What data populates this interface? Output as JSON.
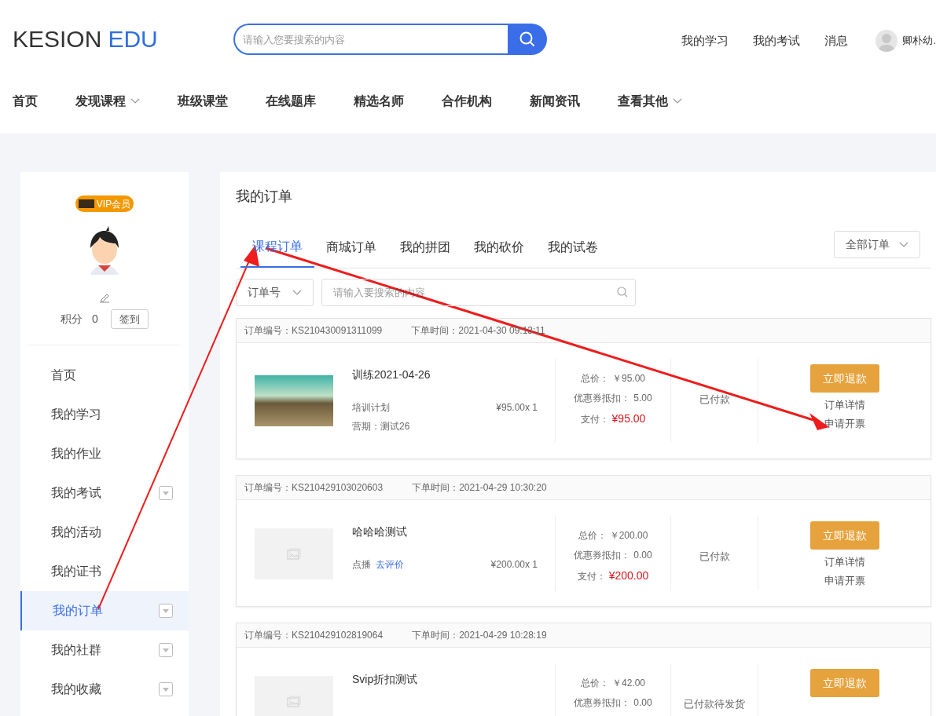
{
  "logo": {
    "part1": "KESION",
    "part2": "EDU"
  },
  "search": {
    "placeholder": "请输入您要搜索的内容"
  },
  "top_links": [
    "我的学习",
    "我的考试",
    "消息"
  ],
  "user": {
    "name": "卿朴幼."
  },
  "nav": [
    {
      "label": "首页",
      "dropdown": false
    },
    {
      "label": "发现课程",
      "dropdown": true
    },
    {
      "label": "班级课堂",
      "dropdown": false
    },
    {
      "label": "在线题库",
      "dropdown": false
    },
    {
      "label": "精选名师",
      "dropdown": false
    },
    {
      "label": "合作机构",
      "dropdown": false
    },
    {
      "label": "新闻资讯",
      "dropdown": false
    },
    {
      "label": "查看其他",
      "dropdown": true
    }
  ],
  "profile": {
    "badge": "VIP会员",
    "points_label": "积分",
    "points": "0",
    "checkin": "签到"
  },
  "sidebar": {
    "items": [
      {
        "label": "首页",
        "selected": false,
        "expandable": false
      },
      {
        "label": "我的学习",
        "selected": false,
        "expandable": false
      },
      {
        "label": "我的作业",
        "selected": false,
        "expandable": false
      },
      {
        "label": "我的考试",
        "selected": false,
        "expandable": true
      },
      {
        "label": "我的活动",
        "selected": false,
        "expandable": false
      },
      {
        "label": "我的证书",
        "selected": false,
        "expandable": false
      },
      {
        "label": "我的订单",
        "selected": true,
        "expandable": true
      },
      {
        "label": "我的社群",
        "selected": false,
        "expandable": true
      },
      {
        "label": "我的收藏",
        "selected": false,
        "expandable": true
      }
    ]
  },
  "page_title": "我的订单",
  "tabs": [
    {
      "label": "课程订单",
      "selected": true
    },
    {
      "label": "商城订单",
      "selected": false
    },
    {
      "label": "我的拼团",
      "selected": false
    },
    {
      "label": "我的砍价",
      "selected": false
    },
    {
      "label": "我的试卷",
      "selected": false
    }
  ],
  "order_filter": "全部订单",
  "search_type": "订单号",
  "order_search": {
    "placeholder": "请输入要搜索的内容"
  },
  "orders": [
    {
      "order_no": "订单编号：KS210430091311099",
      "time": "下单时间：2021-04-30 09:13:11",
      "kind": "photo",
      "title": "训练2021-04-26",
      "type": "培训计划",
      "camp": "营期：测试26",
      "unit_price": "¥95.00x 1",
      "total_label": "总价：",
      "total": "￥95.00",
      "discount_label": "优惠券抵扣：",
      "discount": "5.00",
      "paid_label": "支付：",
      "paid": "¥95.00",
      "status": "已付款",
      "refund": "立即退款",
      "actions": [
        "订单详情",
        "申请开票"
      ]
    },
    {
      "order_no": "订单编号：KS210429103020603",
      "time": "下单时间：2021-04-29 10:30:20",
      "kind": "placeholder",
      "title": "哈哈哈测试",
      "type": "点播",
      "review": "去评价",
      "unit_price": "¥200.00x 1",
      "total_label": "总价：",
      "total": "￥200.00",
      "discount_label": "优惠券抵扣：",
      "discount": "0.00",
      "paid_label": "支付：",
      "paid": "¥200.00",
      "status": "已付款",
      "refund": "立即退款",
      "actions": [
        "订单详情",
        "申请开票"
      ]
    },
    {
      "order_no": "订单编号：KS210429102819064",
      "time": "下单时间：2021-04-29 10:28:19",
      "kind": "placeholder",
      "title": "Svip折扣测试",
      "total_label": "总价：",
      "total": "￥42.00",
      "discount_label": "优惠券抵扣：",
      "discount": "0.00",
      "status": "已付款待发货",
      "refund": "立即退款"
    }
  ]
}
